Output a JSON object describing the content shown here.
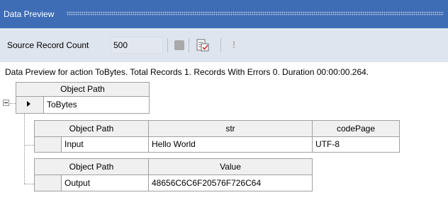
{
  "window": {
    "title": "Data Preview"
  },
  "toolbar": {
    "source_label": "Source Record Count",
    "source_count": "500",
    "stop_icon": "stop-icon",
    "preview_icon": "preview-checklist-icon",
    "alert_icon": "exclamation-icon",
    "alert_glyph": "!"
  },
  "status_text": "Data Preview for action ToBytes. Total Records 1. Records With Errors 0. Duration 00:00:00.264.",
  "root_grid": {
    "header": "Object Path",
    "row_value": "ToBytes",
    "expander_icon": "minus-expander-icon",
    "current_row_icon": "row-pointer-icon"
  },
  "input_grid": {
    "headers": [
      "Object Path",
      "str",
      "codePage"
    ],
    "row": [
      "Input",
      "Hello World",
      "UTF-8"
    ]
  },
  "output_grid": {
    "headers": [
      "Object Path",
      "Value"
    ],
    "row": [
      "Output",
      "48656C6C6F20576F726C64"
    ]
  },
  "colors": {
    "titlebar": "#3e6db5",
    "toolbar": "#dfe5ee",
    "grid_header": "#f0f0f0",
    "grid_border": "#a0a0a0"
  }
}
